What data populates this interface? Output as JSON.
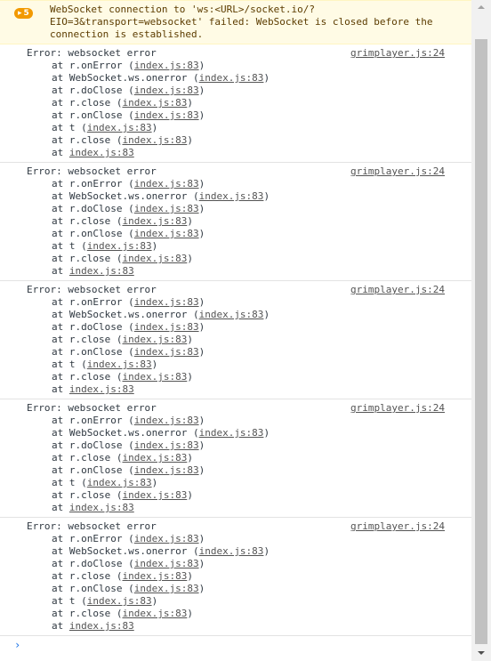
{
  "warning": {
    "count": "5",
    "message": "WebSocket connection to 'ws:<URL>/socket.io/?\nEIO=3&transport=websocket' failed: WebSocket is closed before the\nconnection is established."
  },
  "errors": [
    {
      "message": "Error: websocket error",
      "source": "grimplayer.js:24",
      "frames": [
        {
          "pre": "at r.onError (",
          "link": "index.js:83",
          "post": ")"
        },
        {
          "pre": "at WebSocket.ws.onerror (",
          "link": "index.js:83",
          "post": ")"
        },
        {
          "pre": "at r.doClose (",
          "link": "index.js:83",
          "post": ")"
        },
        {
          "pre": "at r.close (",
          "link": "index.js:83",
          "post": ")"
        },
        {
          "pre": "at r.onClose (",
          "link": "index.js:83",
          "post": ")"
        },
        {
          "pre": "at t (",
          "link": "index.js:83",
          "post": ")"
        },
        {
          "pre": "at r.close (",
          "link": "index.js:83",
          "post": ")"
        },
        {
          "pre": "at ",
          "link": "index.js:83",
          "post": ""
        }
      ]
    },
    {
      "message": "Error: websocket error",
      "source": "grimplayer.js:24",
      "frames": [
        {
          "pre": "at r.onError (",
          "link": "index.js:83",
          "post": ")"
        },
        {
          "pre": "at WebSocket.ws.onerror (",
          "link": "index.js:83",
          "post": ")"
        },
        {
          "pre": "at r.doClose (",
          "link": "index.js:83",
          "post": ")"
        },
        {
          "pre": "at r.close (",
          "link": "index.js:83",
          "post": ")"
        },
        {
          "pre": "at r.onClose (",
          "link": "index.js:83",
          "post": ")"
        },
        {
          "pre": "at t (",
          "link": "index.js:83",
          "post": ")"
        },
        {
          "pre": "at r.close (",
          "link": "index.js:83",
          "post": ")"
        },
        {
          "pre": "at ",
          "link": "index.js:83",
          "post": ""
        }
      ]
    },
    {
      "message": "Error: websocket error",
      "source": "grimplayer.js:24",
      "frames": [
        {
          "pre": "at r.onError (",
          "link": "index.js:83",
          "post": ")"
        },
        {
          "pre": "at WebSocket.ws.onerror (",
          "link": "index.js:83",
          "post": ")"
        },
        {
          "pre": "at r.doClose (",
          "link": "index.js:83",
          "post": ")"
        },
        {
          "pre": "at r.close (",
          "link": "index.js:83",
          "post": ")"
        },
        {
          "pre": "at r.onClose (",
          "link": "index.js:83",
          "post": ")"
        },
        {
          "pre": "at t (",
          "link": "index.js:83",
          "post": ")"
        },
        {
          "pre": "at r.close (",
          "link": "index.js:83",
          "post": ")"
        },
        {
          "pre": "at ",
          "link": "index.js:83",
          "post": ""
        }
      ]
    },
    {
      "message": "Error: websocket error",
      "source": "grimplayer.js:24",
      "frames": [
        {
          "pre": "at r.onError (",
          "link": "index.js:83",
          "post": ")"
        },
        {
          "pre": "at WebSocket.ws.onerror (",
          "link": "index.js:83",
          "post": ")"
        },
        {
          "pre": "at r.doClose (",
          "link": "index.js:83",
          "post": ")"
        },
        {
          "pre": "at r.close (",
          "link": "index.js:83",
          "post": ")"
        },
        {
          "pre": "at r.onClose (",
          "link": "index.js:83",
          "post": ")"
        },
        {
          "pre": "at t (",
          "link": "index.js:83",
          "post": ")"
        },
        {
          "pre": "at r.close (",
          "link": "index.js:83",
          "post": ")"
        },
        {
          "pre": "at ",
          "link": "index.js:83",
          "post": ""
        }
      ]
    },
    {
      "message": "Error: websocket error",
      "source": "grimplayer.js:24",
      "frames": [
        {
          "pre": "at r.onError (",
          "link": "index.js:83",
          "post": ")"
        },
        {
          "pre": "at WebSocket.ws.onerror (",
          "link": "index.js:83",
          "post": ")"
        },
        {
          "pre": "at r.doClose (",
          "link": "index.js:83",
          "post": ")"
        },
        {
          "pre": "at r.close (",
          "link": "index.js:83",
          "post": ")"
        },
        {
          "pre": "at r.onClose (",
          "link": "index.js:83",
          "post": ")"
        },
        {
          "pre": "at t (",
          "link": "index.js:83",
          "post": ")"
        },
        {
          "pre": "at r.close (",
          "link": "index.js:83",
          "post": ")"
        },
        {
          "pre": "at ",
          "link": "index.js:83",
          "post": ""
        }
      ]
    }
  ],
  "prompt": {
    "icon": "chevron-right-icon",
    "glyph": "›"
  },
  "colors": {
    "warning_bg": "#fffbe5",
    "warning_badge": "#f29900",
    "prompt": "#1a73e8"
  }
}
